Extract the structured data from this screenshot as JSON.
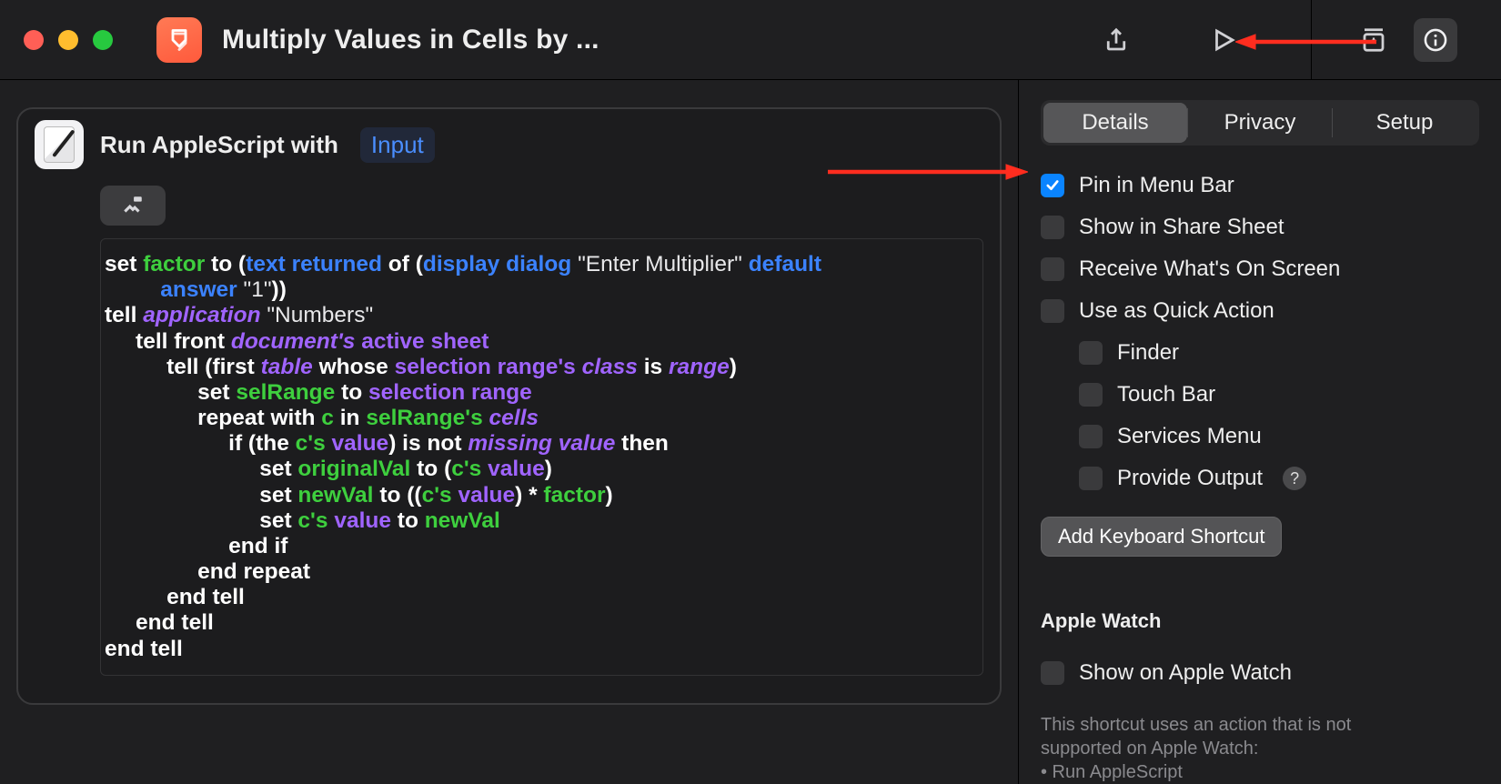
{
  "titlebar": {
    "title": "Multiply Values in Cells by ..."
  },
  "action": {
    "title": "Run AppleScript with",
    "input_token": "Input"
  },
  "sidebar": {
    "tabs": {
      "details": "Details",
      "privacy": "Privacy",
      "setup": "Setup"
    },
    "pin_menu_bar": "Pin in Menu Bar",
    "show_share_sheet": "Show in Share Sheet",
    "receive_whats_on_screen": "Receive What's On Screen",
    "use_quick_action": "Use as Quick Action",
    "qa_finder": "Finder",
    "qa_touchbar": "Touch Bar",
    "qa_services": "Services Menu",
    "qa_output": "Provide Output",
    "add_shortcut": "Add Keyboard Shortcut",
    "watch_heading": "Apple Watch",
    "watch_show": "Show on Apple Watch",
    "watch_note_l1": "This shortcut uses an action that is not",
    "watch_note_l2": "supported on Apple Watch:",
    "watch_note_l3": "• Run AppleScript"
  }
}
